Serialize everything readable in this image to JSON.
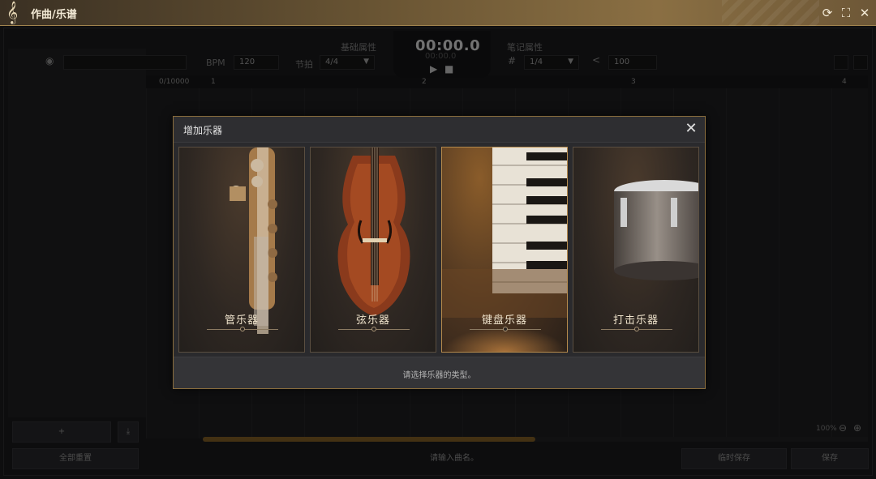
{
  "window": {
    "title": "作曲/乐谱",
    "clef_glyph": "𝄞",
    "buttons": {
      "refresh": "⟳",
      "fullscreen": "⛶",
      "close": "✕"
    }
  },
  "toolbar": {
    "basic_props_label": "基础属性",
    "note_props_label": "笔记属性",
    "bpm_label": "BPM",
    "bpm_value": "120",
    "beat_label": "节拍",
    "beat_value": "4/4",
    "timer": "00:00.0",
    "timer_sub": "00:00.0",
    "note_value": "1/4",
    "velocity_value": "100"
  },
  "ruler": {
    "counter": "0/10000",
    "marks": [
      "1",
      "2",
      "3",
      "4"
    ]
  },
  "bottom": {
    "reset_all": "全部重置",
    "name_placeholder": "请输入曲名。",
    "temp_save": "临时保存",
    "save": "保存",
    "zoom": "100%"
  },
  "modal": {
    "title": "增加乐器",
    "hint": "请选择乐器的类型。",
    "cards": [
      {
        "label": "管乐器"
      },
      {
        "label": "弦乐器"
      },
      {
        "label": "键盘乐器"
      },
      {
        "label": "打击乐器"
      }
    ]
  }
}
